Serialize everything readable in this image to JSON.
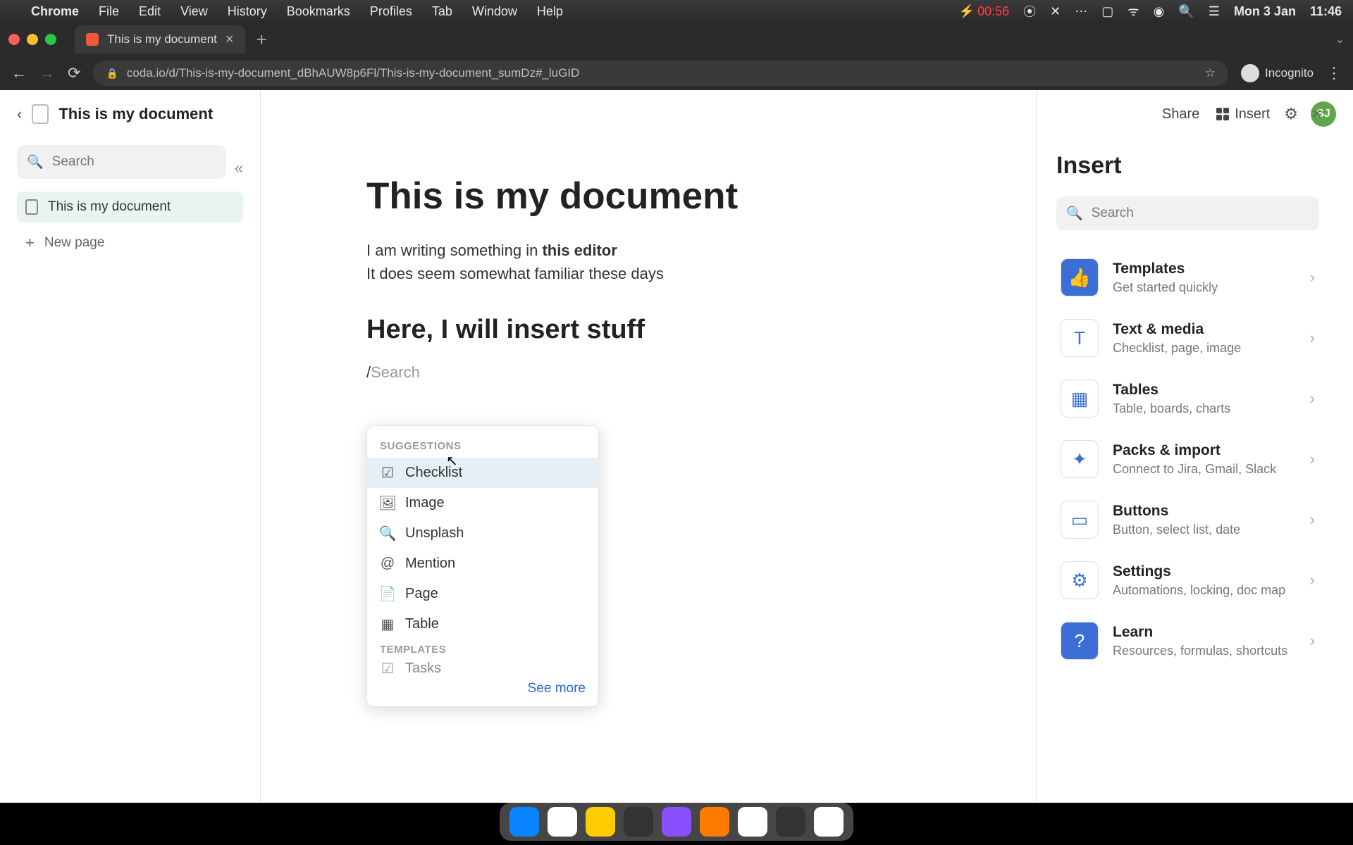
{
  "menubar": {
    "app": "Chrome",
    "items": [
      "File",
      "Edit",
      "View",
      "History",
      "Bookmarks",
      "Profiles",
      "Tab",
      "Window",
      "Help"
    ],
    "battery_time": "00:56",
    "date": "Mon 3 Jan",
    "time": "11:46"
  },
  "browser": {
    "tab_title": "This is my document",
    "url": "coda.io/d/This-is-my-document_dBhAUW8p6Fl/This-is-my-document_sumDz#_luGID",
    "incognito": "Incognito"
  },
  "header": {
    "doc_title": "This is my document",
    "share": "Share",
    "insert": "Insert",
    "avatar": "SJ"
  },
  "leftbar": {
    "search_placeholder": "Search",
    "page_item": "This is my document",
    "new_page": "New page"
  },
  "editor": {
    "h1": "This is my document",
    "line1a": "I am writing something in ",
    "line1b": "this editor",
    "line2": "It does seem somewhat familiar these days",
    "h2": "Here, I will insert stuff",
    "slash_placeholder": "Search"
  },
  "popover": {
    "sec1": "SUGGESTIONS",
    "items": [
      "Checklist",
      "Image",
      "Unsplash",
      "Mention",
      "Page",
      "Table"
    ],
    "sec2": "TEMPLATES",
    "items2": [
      "Tasks"
    ],
    "see_more": "See more"
  },
  "insert_panel": {
    "title": "Insert",
    "search_placeholder": "Search",
    "entries": [
      {
        "t": "Templates",
        "s": "Get started quickly",
        "ic": "👍"
      },
      {
        "t": "Text & media",
        "s": "Checklist, page, image",
        "ic": "T"
      },
      {
        "t": "Tables",
        "s": "Table, boards, charts",
        "ic": "▦"
      },
      {
        "t": "Packs & import",
        "s": "Connect to Jira, Gmail, Slack",
        "ic": "✦"
      },
      {
        "t": "Buttons",
        "s": "Button, select list, date",
        "ic": "▭"
      },
      {
        "t": "Settings",
        "s": "Automations, locking, doc map",
        "ic": "⚙"
      },
      {
        "t": "Learn",
        "s": "Resources, formulas, shortcuts",
        "ic": "?"
      }
    ]
  }
}
